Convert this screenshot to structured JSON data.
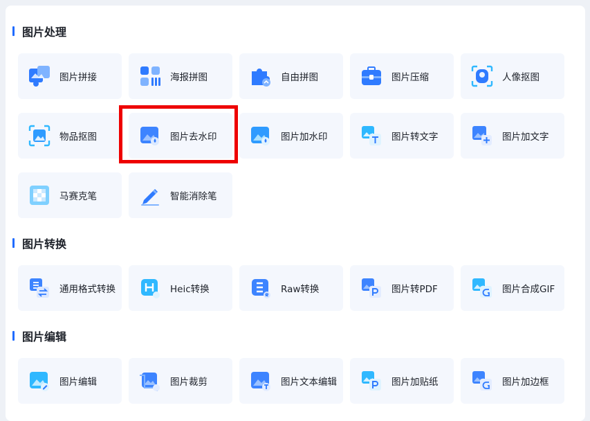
{
  "sections": [
    {
      "title": "图片处理",
      "items": [
        {
          "label": "图片拼接",
          "icon": "puzzle-icon"
        },
        {
          "label": "海报拼图",
          "icon": "poster-grid-icon"
        },
        {
          "label": "自由拼图",
          "icon": "jigsaw-icon"
        },
        {
          "label": "图片压缩",
          "icon": "compress-icon"
        },
        {
          "label": "人像抠图",
          "icon": "portrait-cutout-icon"
        },
        {
          "label": "物品抠图",
          "icon": "object-cutout-icon"
        },
        {
          "label": "图片去水印",
          "icon": "remove-watermark-icon"
        },
        {
          "label": "图片加水印",
          "icon": "add-watermark-icon"
        },
        {
          "label": "图片转文字",
          "icon": "image-to-text-icon"
        },
        {
          "label": "图片加文字",
          "icon": "add-text-icon"
        },
        {
          "label": "马赛克笔",
          "icon": "mosaic-icon"
        },
        {
          "label": "智能消除笔",
          "icon": "smart-eraser-pen-icon"
        }
      ]
    },
    {
      "title": "图片转换",
      "items": [
        {
          "label": "通用格式转换",
          "icon": "format-convert-icon"
        },
        {
          "label": "Heic转换",
          "icon": "heic-convert-icon"
        },
        {
          "label": "Raw转换",
          "icon": "raw-convert-icon"
        },
        {
          "label": "图片转PDF",
          "icon": "image-to-pdf-icon"
        },
        {
          "label": "图片合成GIF",
          "icon": "gif-compose-icon"
        }
      ]
    },
    {
      "title": "图片编辑",
      "items": [
        {
          "label": "图片编辑",
          "icon": "image-edit-icon"
        },
        {
          "label": "图片裁剪",
          "icon": "image-crop-icon"
        },
        {
          "label": "图片文本编辑",
          "icon": "image-text-edit-icon"
        },
        {
          "label": "图片加贴纸",
          "icon": "add-sticker-icon"
        },
        {
          "label": "图片加边框",
          "icon": "add-border-icon"
        }
      ]
    }
  ],
  "colors": {
    "accent": "#1f6bff",
    "tile_bg": "#f4f7fd",
    "highlight": "#ee0000"
  }
}
